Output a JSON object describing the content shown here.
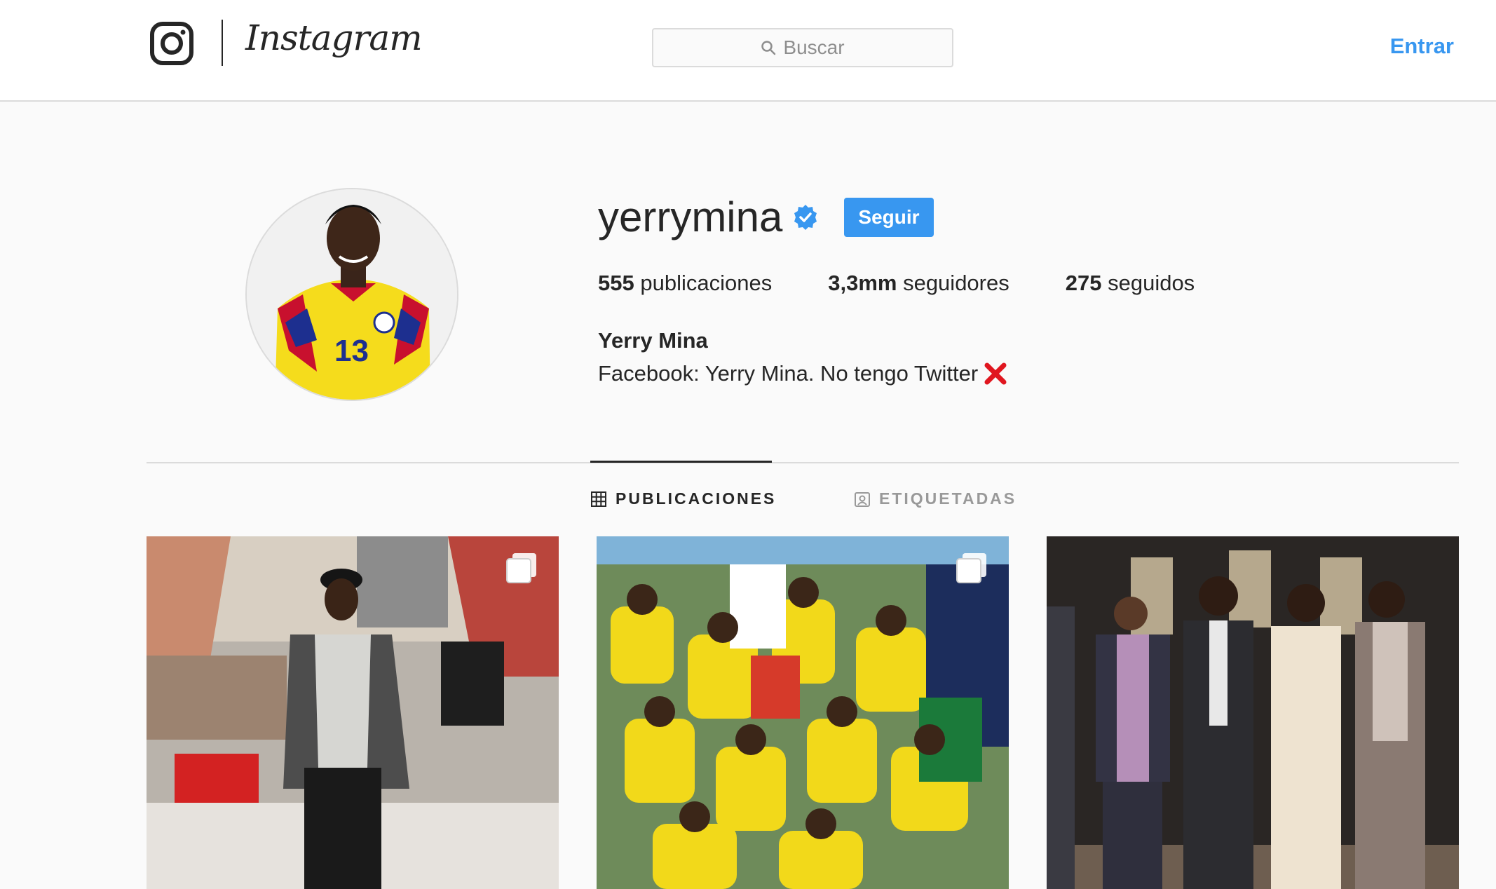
{
  "header": {
    "logo_text": "Instagram",
    "search_placeholder": "Buscar",
    "login_label": "Entrar"
  },
  "profile": {
    "username": "yerrymina",
    "verified": true,
    "follow_label": "Seguir",
    "stats": {
      "posts_count": "555",
      "posts_label": "publicaciones",
      "followers_count": "3,3mm",
      "followers_label": "seguidores",
      "following_count": "275",
      "following_label": "seguidos"
    },
    "full_name": "Yerry Mina",
    "bio": "Facebook: Yerry Mina. No tengo Twitter"
  },
  "tabs": [
    {
      "label": "PUBLICACIONES",
      "active": true,
      "icon": "grid-icon"
    },
    {
      "label": "ETIQUETADAS",
      "active": false,
      "icon": "tagged-icon"
    }
  ],
  "colors": {
    "accent": "#3897f0",
    "text": "#262626",
    "muted": "#8e8e8e",
    "border": "#dbdbdb",
    "background": "#fafafa",
    "bio_x": "#e0161f"
  }
}
